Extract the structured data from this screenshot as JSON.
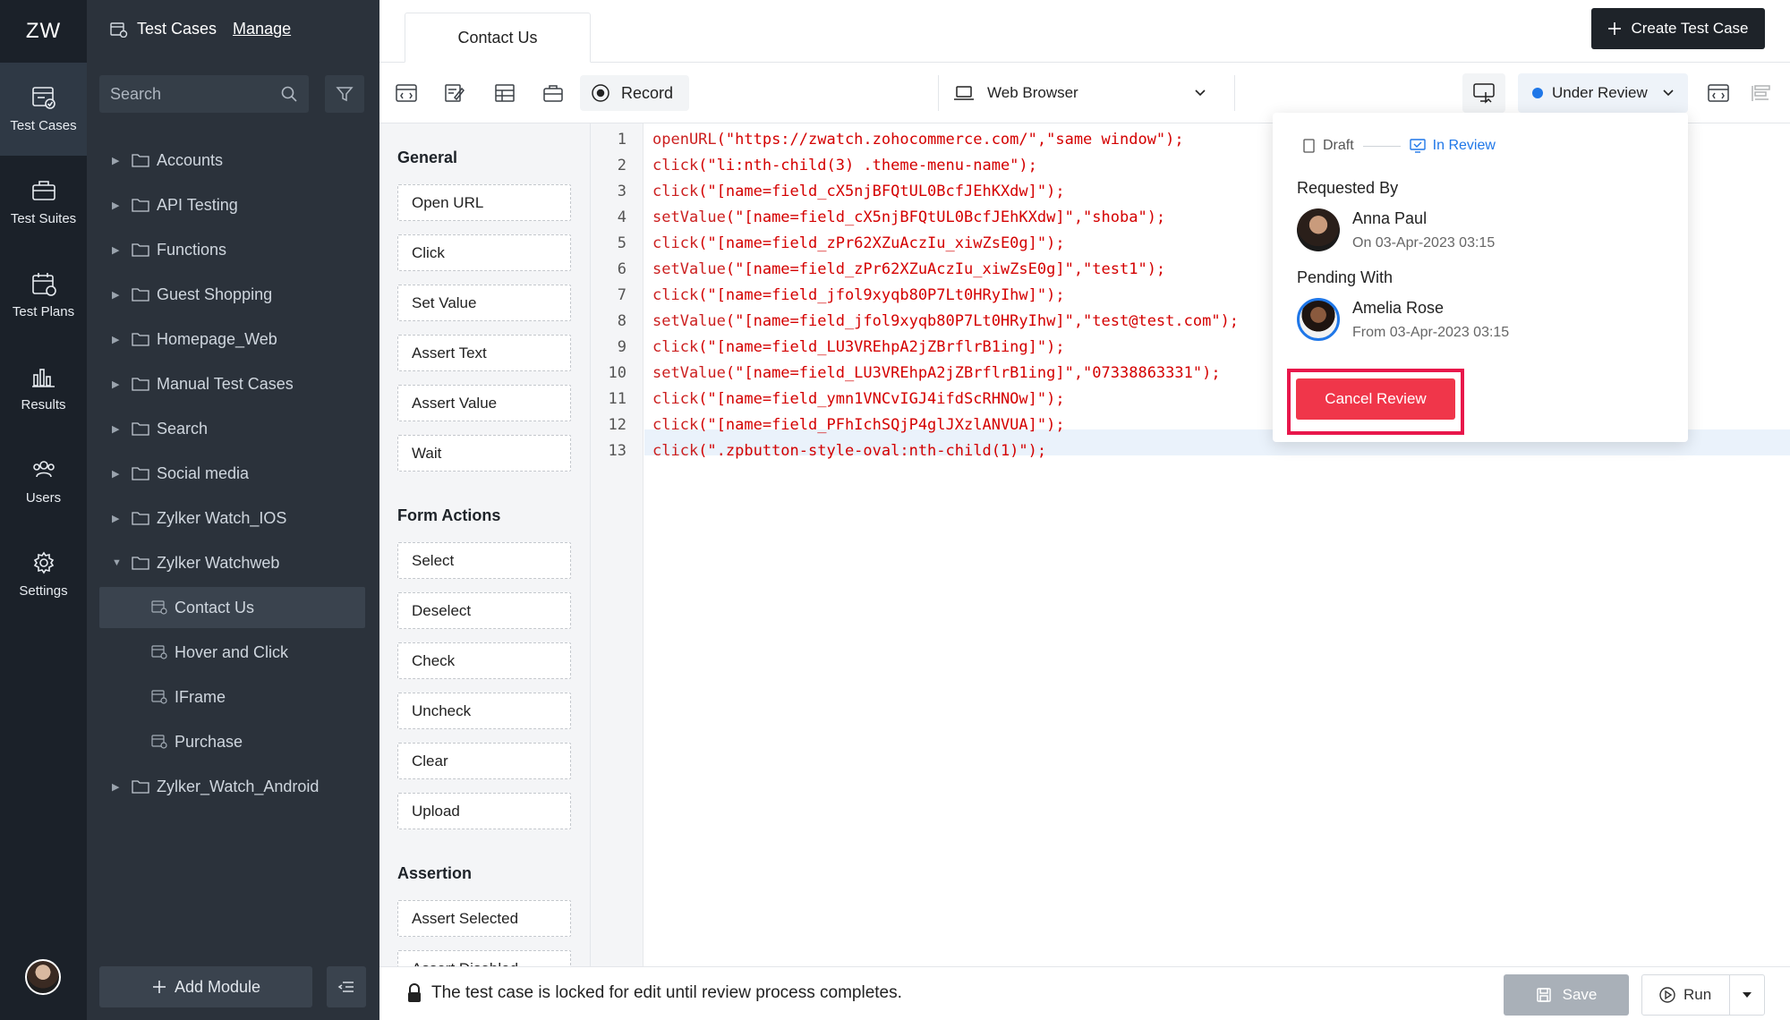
{
  "app": {
    "logo": "ZW"
  },
  "rail": [
    {
      "label": "Test Cases",
      "icon": "test-cases-icon",
      "active": true
    },
    {
      "label": "Test Suites",
      "icon": "test-suites-icon"
    },
    {
      "label": "Test Plans",
      "icon": "test-plans-icon"
    },
    {
      "label": "Results",
      "icon": "results-icon"
    },
    {
      "label": "Users",
      "icon": "users-icon"
    },
    {
      "label": "Settings",
      "icon": "gear-icon"
    }
  ],
  "tree": {
    "title": "Test Cases",
    "manage": "Manage",
    "search_placeholder": "Search",
    "items": [
      {
        "label": "Accounts",
        "type": "folder"
      },
      {
        "label": "API Testing",
        "type": "folder"
      },
      {
        "label": "Functions",
        "type": "folder"
      },
      {
        "label": "Guest Shopping",
        "type": "folder"
      },
      {
        "label": "Homepage_Web",
        "type": "folder"
      },
      {
        "label": "Manual Test Cases",
        "type": "folder"
      },
      {
        "label": "Search",
        "type": "folder"
      },
      {
        "label": "Social media",
        "type": "folder"
      },
      {
        "label": "Zylker Watch_IOS",
        "type": "folder"
      },
      {
        "label": "Zylker Watchweb",
        "type": "folder",
        "expanded": true
      },
      {
        "label": "Contact Us",
        "type": "file",
        "selected": true
      },
      {
        "label": "Hover and Click",
        "type": "file"
      },
      {
        "label": "IFrame",
        "type": "file"
      },
      {
        "label": "Purchase",
        "type": "file"
      },
      {
        "label": "Zylker_Watch_Android",
        "type": "folder"
      }
    ],
    "add_module": "Add Module"
  },
  "topbar": {
    "tab": "Contact Us",
    "create_button": "Create Test Case"
  },
  "toolbar": {
    "record": "Record",
    "browser": "Web Browser",
    "status": "Under Review",
    "status_color": "#1f77e8"
  },
  "actions": {
    "general_title": "General",
    "general": [
      "Open URL",
      "Click",
      "Set Value",
      "Assert Text",
      "Assert Value",
      "Wait"
    ],
    "form_title": "Form Actions",
    "form": [
      "Select",
      "Deselect",
      "Check",
      "Uncheck",
      "Clear",
      "Upload"
    ],
    "assertion_title": "Assertion",
    "assertion": [
      "Assert Selected",
      "Assert Disabled"
    ]
  },
  "code": [
    {
      "fn": "openURL",
      "args": "(\"https://zwatch.zohocommerce.com/\",\"same window\");"
    },
    {
      "fn": "click",
      "args": "(\"li:nth-child(3) .theme-menu-name\");"
    },
    {
      "fn": "click",
      "args": "(\"[name=field_cX5njBFQtUL0BcfJEhKXdw]\");"
    },
    {
      "fn": "setValue",
      "args": "(\"[name=field_cX5njBFQtUL0BcfJEhKXdw]\",\"shoba\");"
    },
    {
      "fn": "click",
      "args": "(\"[name=field_zPr62XZuAczIu_xiwZsE0g]\");"
    },
    {
      "fn": "setValue",
      "args": "(\"[name=field_zPr62XZuAczIu_xiwZsE0g]\",\"test1\");"
    },
    {
      "fn": "click",
      "args": "(\"[name=field_jfol9xyqb80P7Lt0HRyIhw]\");"
    },
    {
      "fn": "setValue",
      "args": "(\"[name=field_jfol9xyqb80P7Lt0HRyIhw]\",\"test@test.com\");"
    },
    {
      "fn": "click",
      "args": "(\"[name=field_LU3VREhpA2jZBrflrB1ing]\");"
    },
    {
      "fn": "setValue",
      "args": "(\"[name=field_LU3VREhpA2jZBrflrB1ing]\",\"07338863331\");"
    },
    {
      "fn": "click",
      "args": "(\"[name=field_ymn1VNCvIGJ4ifdScRHNOw]\");"
    },
    {
      "fn": "click",
      "args": "(\"[name=field_PFhIchSQjP4glJXzlANVUA]\");"
    },
    {
      "fn": "click",
      "args": "(\".zpbutton-style-oval:nth-child(1)\");"
    }
  ],
  "review": {
    "step_draft": "Draft",
    "step_review": "In Review",
    "requested_label": "Requested By",
    "requested_name": "Anna Paul",
    "requested_date": "On 03-Apr-2023 03:15",
    "pending_label": "Pending With",
    "pending_name": "Amelia Rose",
    "pending_date": "From 03-Apr-2023 03:15",
    "cancel": "Cancel Review",
    "cancel_color": "#f0364a"
  },
  "bottom": {
    "message": "The test case is locked for edit until review process completes.",
    "save": "Save",
    "run": "Run"
  }
}
